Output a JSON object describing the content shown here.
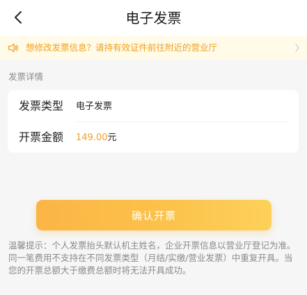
{
  "header": {
    "title": "电子发票"
  },
  "notice": {
    "text": "想修改发票信息？请持有效证件前往附近的营业厅"
  },
  "details": {
    "section_label": "发票详情",
    "rows": [
      {
        "label": "发票类型",
        "value": "电子发票"
      },
      {
        "label": "开票金额",
        "amount": "149.00",
        "unit": "元"
      }
    ]
  },
  "confirm_button": {
    "label": "确认开票"
  },
  "tip": {
    "text": "温馨提示：个人发票抬头默认机主姓名，企业开票信息以营业厅登记为准。同一笔费用不支持在不同发票类型（月结/实缴/营业发票）中重复开具。当您的开票总额大于缴费总额时将无法开具成功。"
  },
  "colors": {
    "accent": "#f2a01d",
    "notice_bg": "#fffbe8",
    "page_bg": "#f6f6f6",
    "button_gradient_start": "#fbb545",
    "button_gradient_end": "#fdd15a"
  },
  "icons": {
    "back": "chevron-left-icon",
    "notice": "speaker-icon",
    "notice_arrow": "chevron-right-icon"
  }
}
